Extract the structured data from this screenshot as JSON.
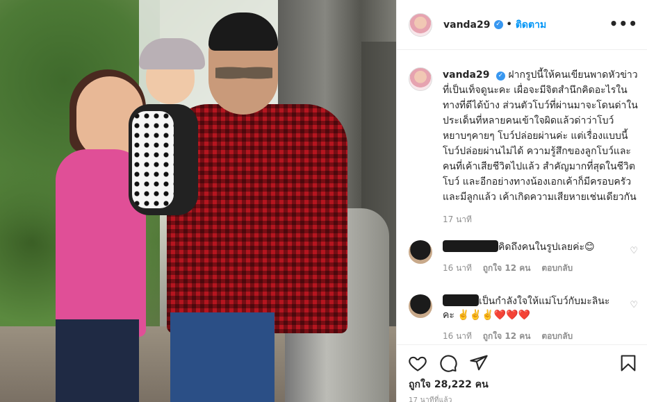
{
  "header": {
    "username": "vanda29",
    "follow_label": "ติดตาม",
    "more_label": "•••"
  },
  "caption": {
    "username": "vanda29",
    "text": "ฝากรูปนี้ให้คนเขียนพาดหัวข่าวที่เป็นเท็จดูนะคะ เผื่อจะมีจิตสำนึกคิดอะไรในทางที่ดีได้บ้าง ส่วนตัวโบว์ที่ผ่านมาจะโดนด่าในประเด็นที่หลายคนเข้าใจผิดแล้วด่าว่าโบว์หยาบๆคายๆ โบว์ปล่อยผ่านค่ะ แต่เรื่องแบบนี้โบว์ปล่อยผ่านไม่ได้ ความรู้สึกของลูกโบว์และคนที่เค้าเสียชีวิตไปแล้ว สำคัญมากที่สุดในชีวิตโบว์ และอีกอย่างทางน้องเอกเค้าก็มีครอบครัวและมีลูกแล้ว เค้าเกิดความเสียหายเช่นเดียวกัน",
    "time": "17 นาที"
  },
  "comments": [
    {
      "text": "คิดถึงคนในรูปเลยค่ะ😊",
      "time": "16 นาที",
      "likes": "ถูกใจ 12 คน",
      "reply": "ตอบกลับ"
    },
    {
      "text": "เป็นกำลังใจให้แม่โบว์กับมะลินะคะ ✌️✌️✌️❤️❤️❤️",
      "time": "16 นาที",
      "likes": "ถูกใจ 12 คน",
      "reply": "ตอบกลับ"
    }
  ],
  "footer": {
    "likes": "ถูกใจ 28,222 คน",
    "posted": "17 นาทีที่แล้ว"
  },
  "icons": [
    "verified-badge-icon",
    "more-options-icon",
    "heart-icon",
    "comment-icon",
    "share-icon",
    "bookmark-icon"
  ],
  "colors": {
    "link_blue": "#0095f6",
    "verified_blue": "#3897f0",
    "muted": "#8e8e8e",
    "text": "#262626"
  }
}
